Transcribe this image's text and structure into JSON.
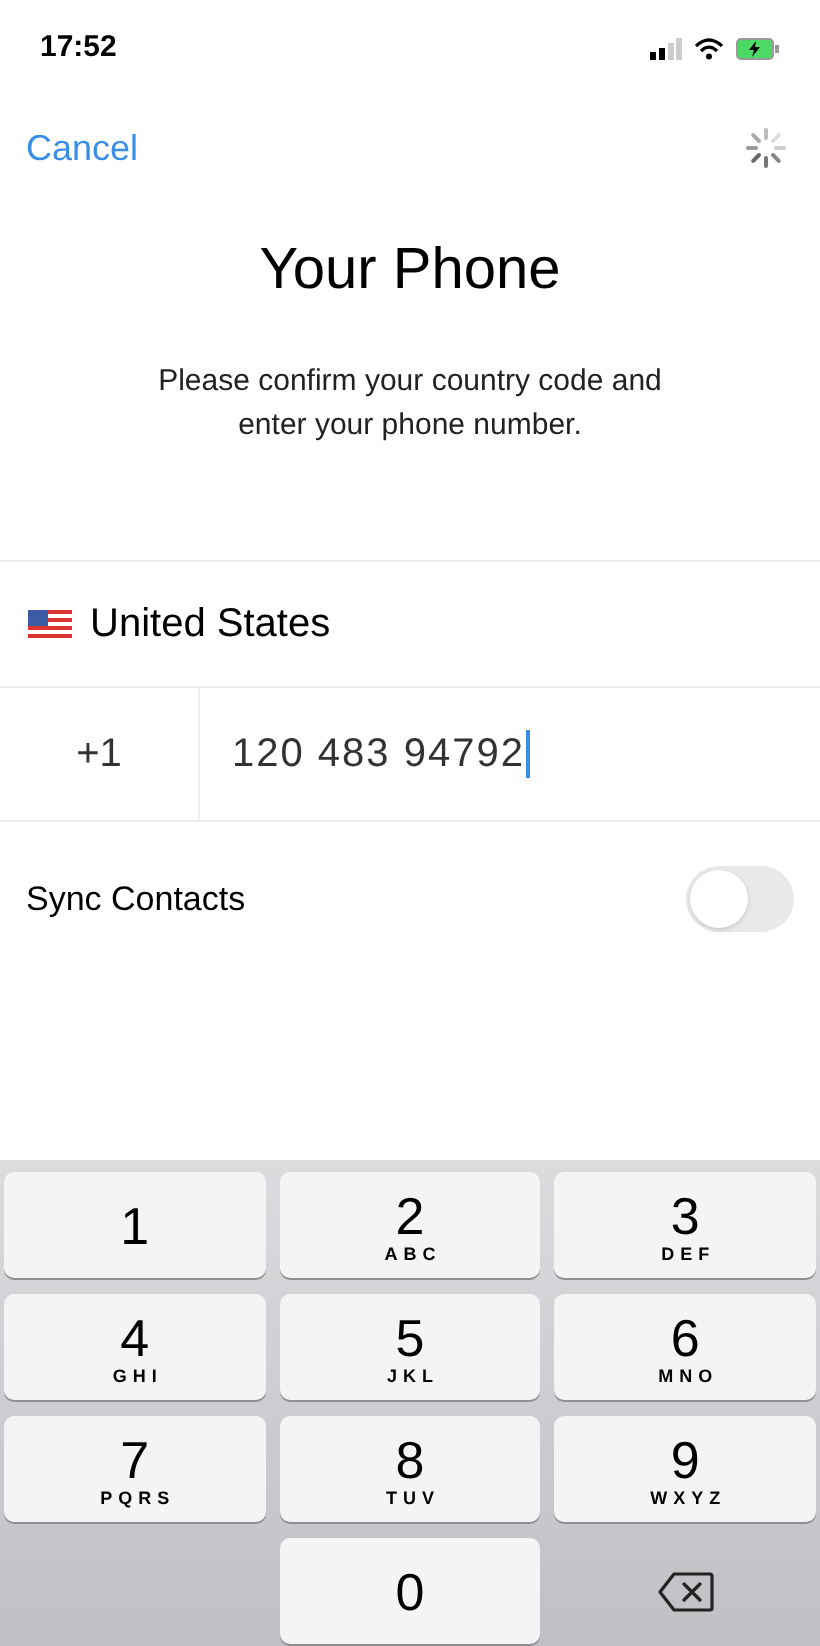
{
  "status_bar": {
    "time": "17:52"
  },
  "nav": {
    "cancel": "Cancel"
  },
  "title": "Your Phone",
  "subtitle": "Please confirm your country code and enter your phone number.",
  "country": {
    "name": "United States"
  },
  "phone": {
    "code": "+1",
    "number": "120 483 94792"
  },
  "sync_contacts": {
    "label": "Sync Contacts",
    "on": false
  },
  "keypad": [
    {
      "kind": "digit",
      "digit": "1"
    },
    {
      "kind": "digit",
      "digit": "2",
      "letters": "ABC"
    },
    {
      "kind": "digit",
      "digit": "3",
      "letters": "DEF"
    },
    {
      "kind": "digit",
      "digit": "4",
      "letters": "GHI"
    },
    {
      "kind": "digit",
      "digit": "5",
      "letters": "JKL"
    },
    {
      "kind": "digit",
      "digit": "6",
      "letters": "MNO"
    },
    {
      "kind": "digit",
      "digit": "7",
      "letters": "PQRS"
    },
    {
      "kind": "digit",
      "digit": "8",
      "letters": "TUV"
    },
    {
      "kind": "digit",
      "digit": "9",
      "letters": "WXYZ"
    },
    {
      "kind": "blank"
    },
    {
      "kind": "digit",
      "digit": "0"
    },
    {
      "kind": "delete"
    }
  ]
}
